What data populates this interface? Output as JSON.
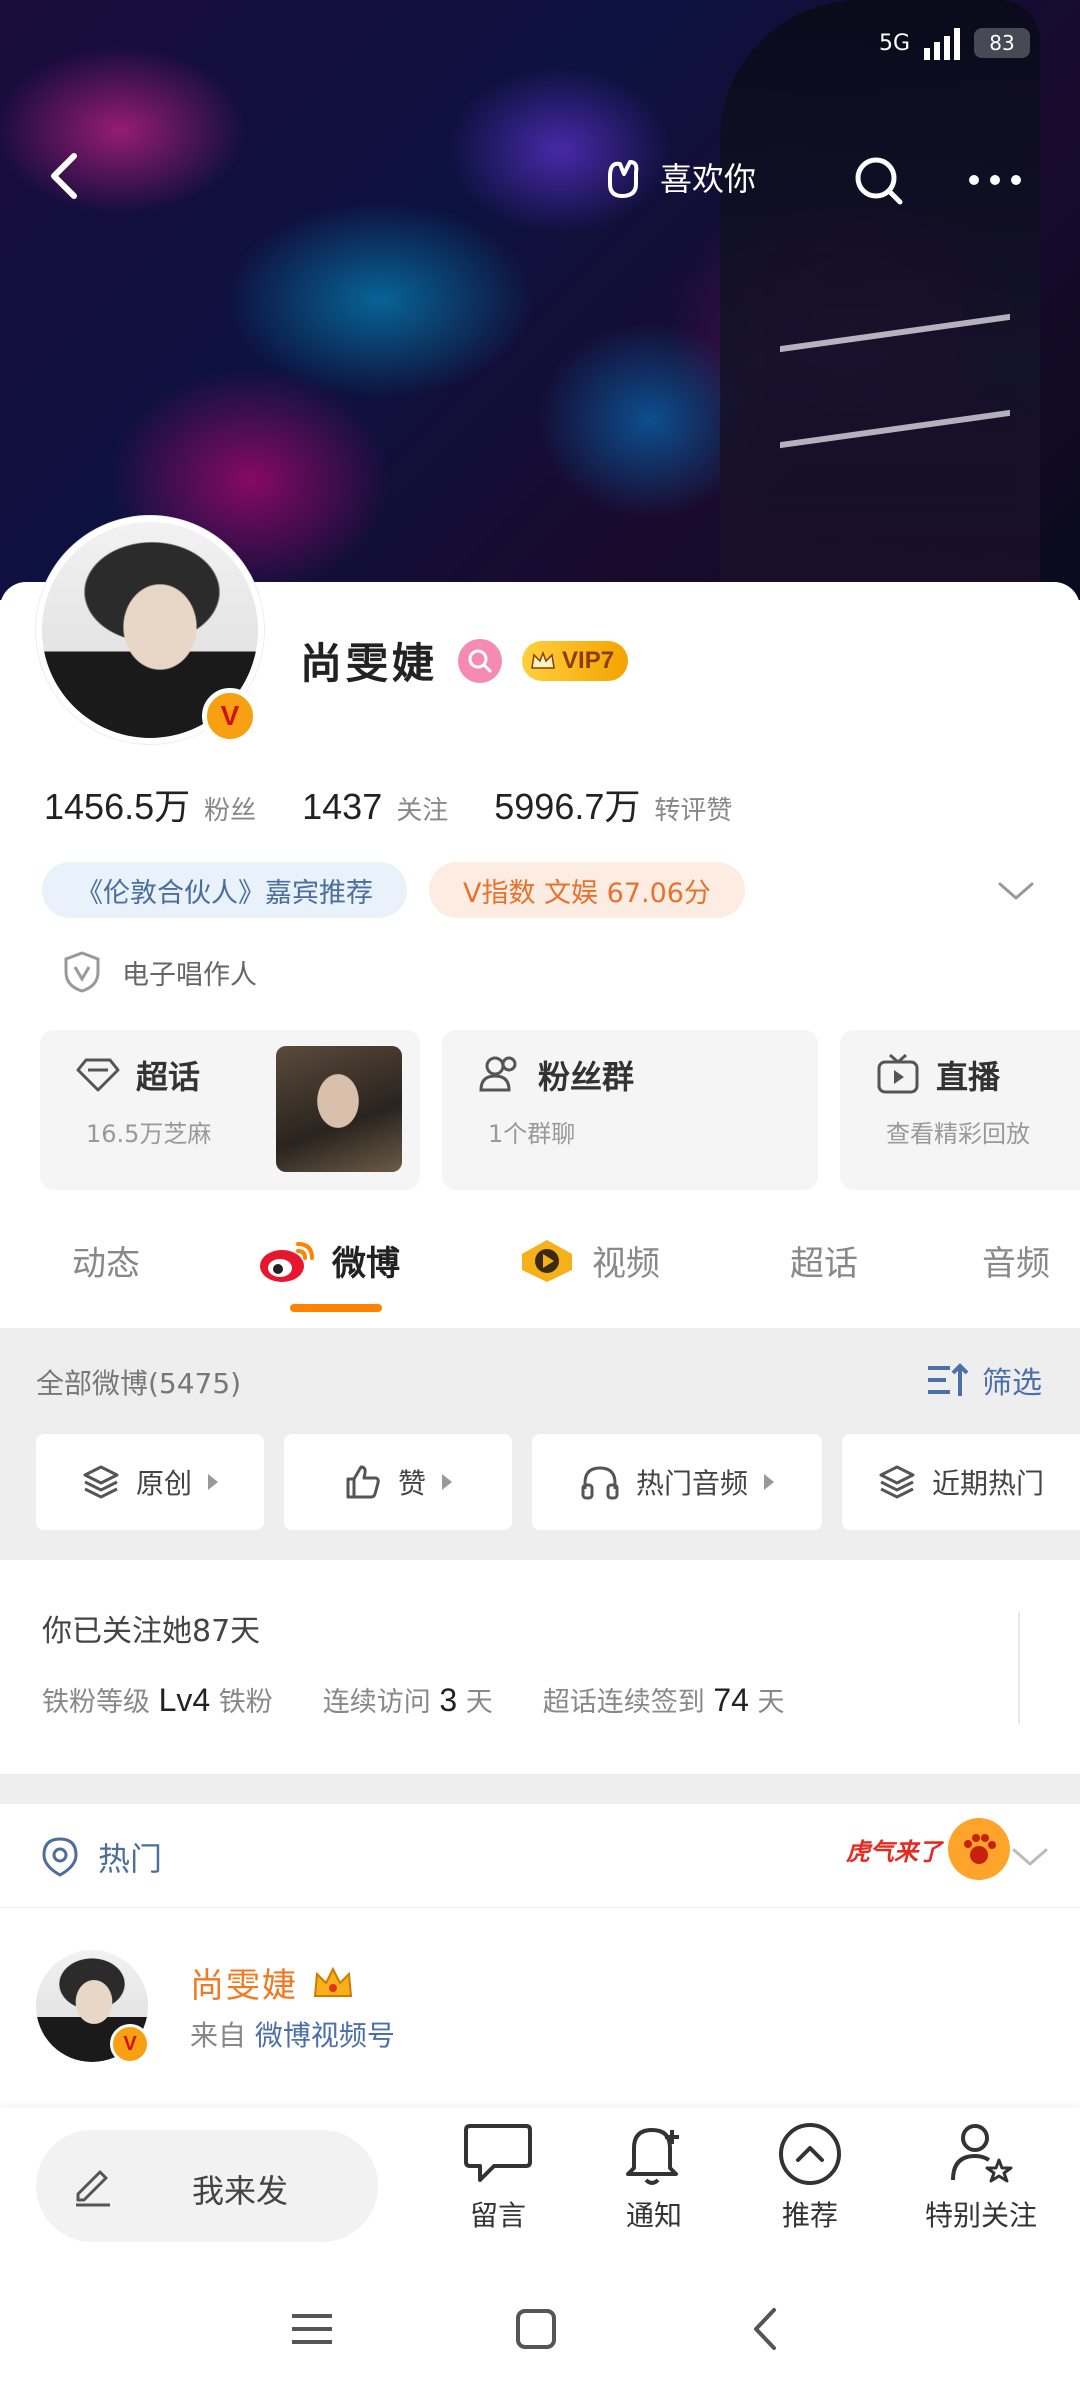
{
  "status": {
    "network": "5G",
    "battery": "83"
  },
  "topbar": {
    "like_label": "喜欢你"
  },
  "profile": {
    "name": "尚雯婕",
    "vip_label": "VIP7",
    "verified_mark": "V",
    "stats": [
      {
        "num": "1456.5万",
        "label": "粉丝"
      },
      {
        "num": "1437",
        "label": "关注"
      },
      {
        "num": "5996.7万",
        "label": "转评赞"
      }
    ],
    "tags": [
      {
        "text": "《伦敦合伙人》嘉宾推荐"
      },
      {
        "text": "V指数 文娱 67.06分"
      }
    ],
    "certification": "电子唱作人"
  },
  "features": [
    {
      "title": "超话",
      "sub": "16.5万芝麻"
    },
    {
      "title": "粉丝群",
      "sub": "1个群聊"
    },
    {
      "title": "直播",
      "sub": "查看精彩回放"
    }
  ],
  "tabs": [
    {
      "label": "动态"
    },
    {
      "label": "微博"
    },
    {
      "label": "视频"
    },
    {
      "label": "超话"
    },
    {
      "label": "音频"
    }
  ],
  "feed": {
    "all_label": "全部微博(5475)",
    "filter_label": "筛选",
    "pills": [
      {
        "label": "原创"
      },
      {
        "label": "赞"
      },
      {
        "label": "热门音频"
      },
      {
        "label": "近期热门"
      }
    ]
  },
  "fan": {
    "line1": "你已关注她87天",
    "level_label": "铁粉等级",
    "level_value": "Lv4",
    "level_suffix": "铁粉",
    "visit_label": "连续访问",
    "visit_value": "3",
    "visit_unit": "天",
    "checkin_label": "超话连续签到",
    "checkin_value": "74",
    "checkin_unit": "天"
  },
  "hot": {
    "label": "热门",
    "promo": "虎气来了"
  },
  "post": {
    "name": "尚雯婕",
    "source_prefix": "来自",
    "source": "微博视频号"
  },
  "actions": {
    "compose": "我来发",
    "items": [
      {
        "label": "留言"
      },
      {
        "label": "通知"
      },
      {
        "label": "推荐"
      },
      {
        "label": "特别关注"
      }
    ]
  },
  "colors": {
    "accent": "#ff8200",
    "link": "#4c6faa",
    "name_orange": "#f07a22"
  }
}
